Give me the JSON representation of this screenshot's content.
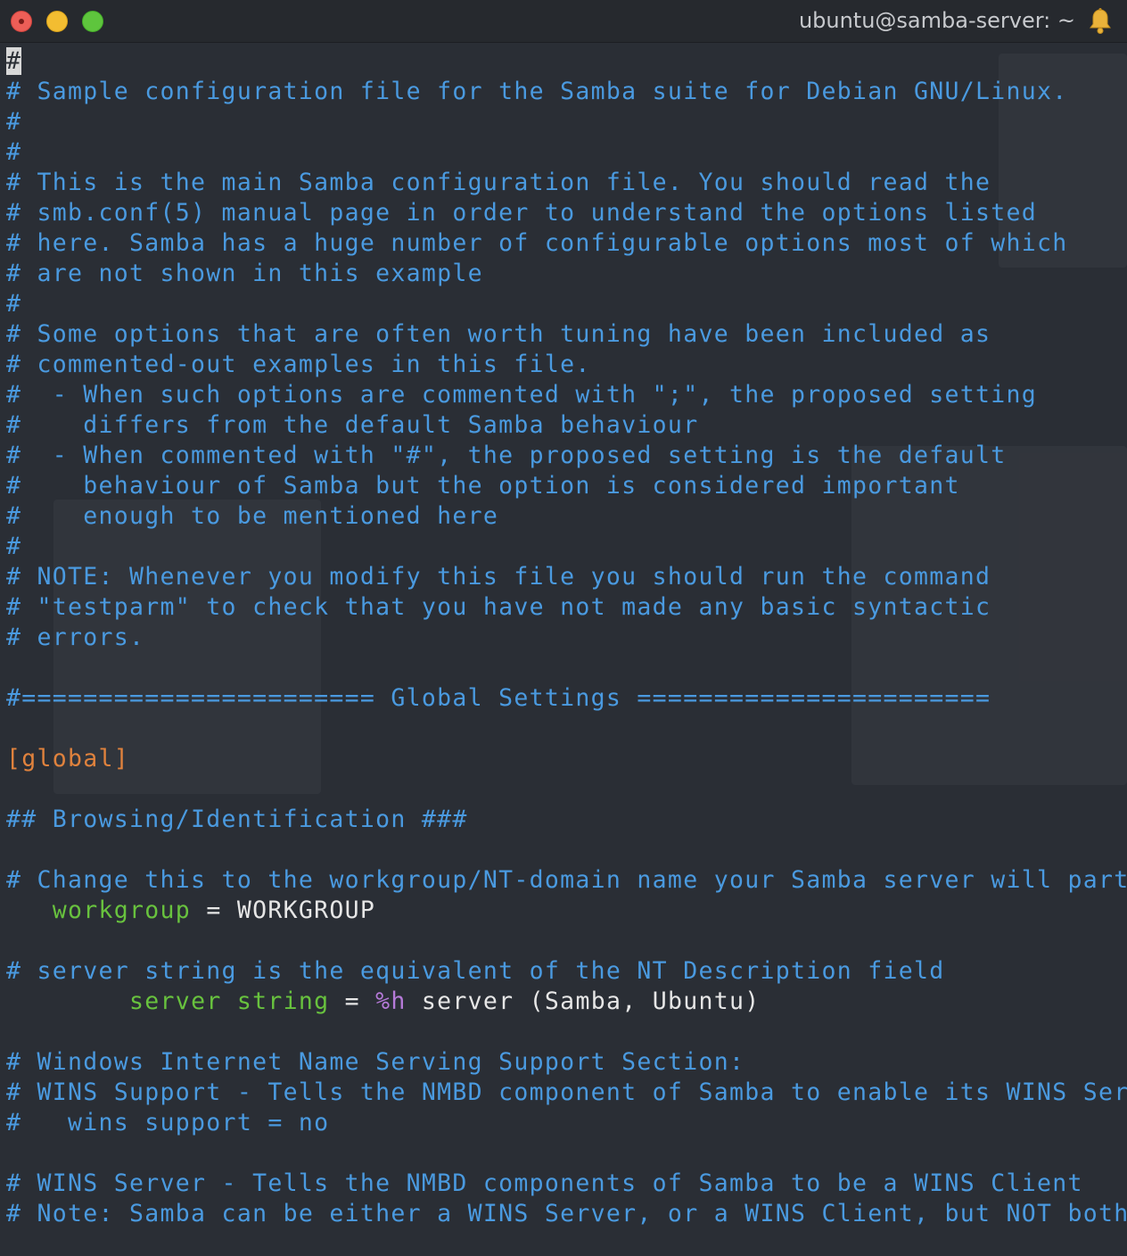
{
  "window": {
    "title": "ubuntu@samba-server: ~",
    "icons": {
      "close": "close-button",
      "minimize": "minimize-button",
      "zoom": "zoom-button",
      "notification": "bell-icon"
    },
    "colors": {
      "comment": "#4a9ae0",
      "section": "#e0823d",
      "key": "#68c23e",
      "value": "#e6e6e6",
      "macro": "#b57ad8",
      "background": "#2a2e35"
    }
  },
  "editor": {
    "cursor_char": "#",
    "lines": [
      "",
      "# Sample configuration file for the Samba suite for Debian GNU/Linux.",
      "#",
      "#",
      "# This is the main Samba configuration file. You should read the",
      "# smb.conf(5) manual page in order to understand the options listed",
      "# here. Samba has a huge number of configurable options most of which",
      "# are not shown in this example",
      "#",
      "# Some options that are often worth tuning have been included as",
      "# commented-out examples in this file.",
      "#  - When such options are commented with \";\", the proposed setting",
      "#    differs from the default Samba behaviour",
      "#  - When commented with \"#\", the proposed setting is the default",
      "#    behaviour of Samba but the option is considered important",
      "#    enough to be mentioned here",
      "#",
      "# NOTE: Whenever you modify this file you should run the command",
      "# \"testparm\" to check that you have not made any basic syntactic",
      "# errors.",
      "",
      "#======================= Global Settings =======================",
      "",
      "[global]",
      "",
      "## Browsing/Identification ###",
      "",
      "# Change this to the workgroup/NT-domain name your Samba server will part of",
      "",
      "",
      "# server string is the equivalent of the NT Description field",
      "",
      "",
      "# Windows Internet Name Serving Support Section:",
      "# WINS Support - Tells the NMBD component of Samba to enable its WINS Server",
      "#   wins support = no",
      "",
      "# WINS Server - Tells the NMBD components of Samba to be a WINS Client",
      "# Note: Samba can be either a WINS Server, or a WINS Client, but NOT both"
    ],
    "workgroup": {
      "indent": "   ",
      "key": "workgroup",
      "sep": " = ",
      "value": "WORKGROUP"
    },
    "server_string": {
      "indent": "        ",
      "key": "server string",
      "sep": " = ",
      "macro": "%h",
      "value": " server (Samba, Ubuntu)"
    }
  }
}
